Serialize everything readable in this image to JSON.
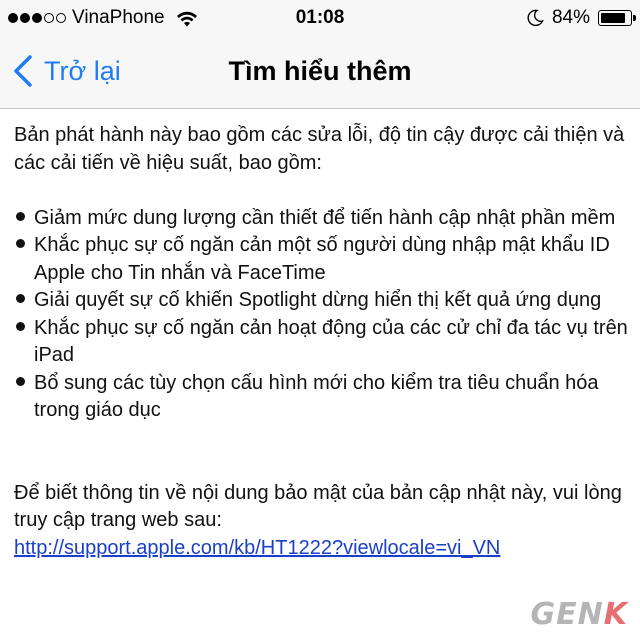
{
  "status_bar": {
    "carrier": "VinaPhone",
    "time": "01:08",
    "battery_text": "84%",
    "battery_level": 0.84,
    "signal_bars_filled": 3,
    "signal_bars_total": 5
  },
  "nav": {
    "back_label": "Trở lại",
    "title": "Tìm hiểu thêm"
  },
  "content": {
    "intro": "Bản phát hành này bao gồm các sửa lỗi, độ tin cậy được cải thiện và các cải tiến về hiệu suất, bao gồm:",
    "bullets": [
      "Giảm mức dung lượng cần thiết để tiến hành cập nhật phần mềm",
      "Khắc phục sự cố ngăn cản một số người dùng nhập mật khẩu ID Apple cho Tin nhắn và FaceTime",
      "Giải quyết sự cố khiến Spotlight dừng hiển thị kết quả ứng dụng",
      "Khắc phục sự cố ngăn cản hoạt động của các cử chỉ đa tác vụ trên iPad",
      "Bổ sung các tùy chọn cấu hình mới cho kiểm tra tiêu chuẩn hóa trong giáo dục"
    ],
    "privacy_text": "Để biết thông tin về nội dung bảo mật của bản cập nhật này, vui lòng truy cập trang web sau:",
    "link": "http://support.apple.com/kb/HT1222?viewlocale=vi_VN"
  },
  "watermark": {
    "part1": "GEN",
    "part2": "K"
  },
  "colors": {
    "accent": "#1e7cf5",
    "link": "#1a3fc9",
    "bar_background": "#f7f7f8"
  }
}
